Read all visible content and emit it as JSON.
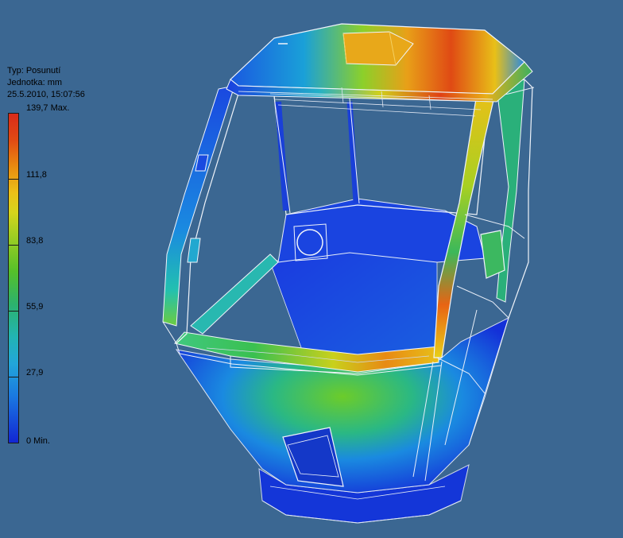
{
  "legend": {
    "type_label": "Typ: Posunutí",
    "unit_label": "Jednotka: mm",
    "timestamp": "25.5.2010, 15:07:56",
    "ticks": [
      {
        "label": "139,7 Max.",
        "value": 139.7
      },
      {
        "label": "111,8",
        "value": 111.8
      },
      {
        "label": "83,8",
        "value": 83.8
      },
      {
        "label": "55,9",
        "value": 55.9
      },
      {
        "label": "27,9",
        "value": 27.9
      },
      {
        "label": "0 Min.",
        "value": 0
      }
    ],
    "max_value": 139.7,
    "min_value": 0,
    "colors": {
      "max": "#d92b1a",
      "high": "#ecc018",
      "mid": "#55c02a",
      "low": "#22b4b4",
      "min": "#1226d4"
    }
  },
  "scene": {
    "background": "#3b6792",
    "model_icon": "cabin-displacement-model"
  }
}
